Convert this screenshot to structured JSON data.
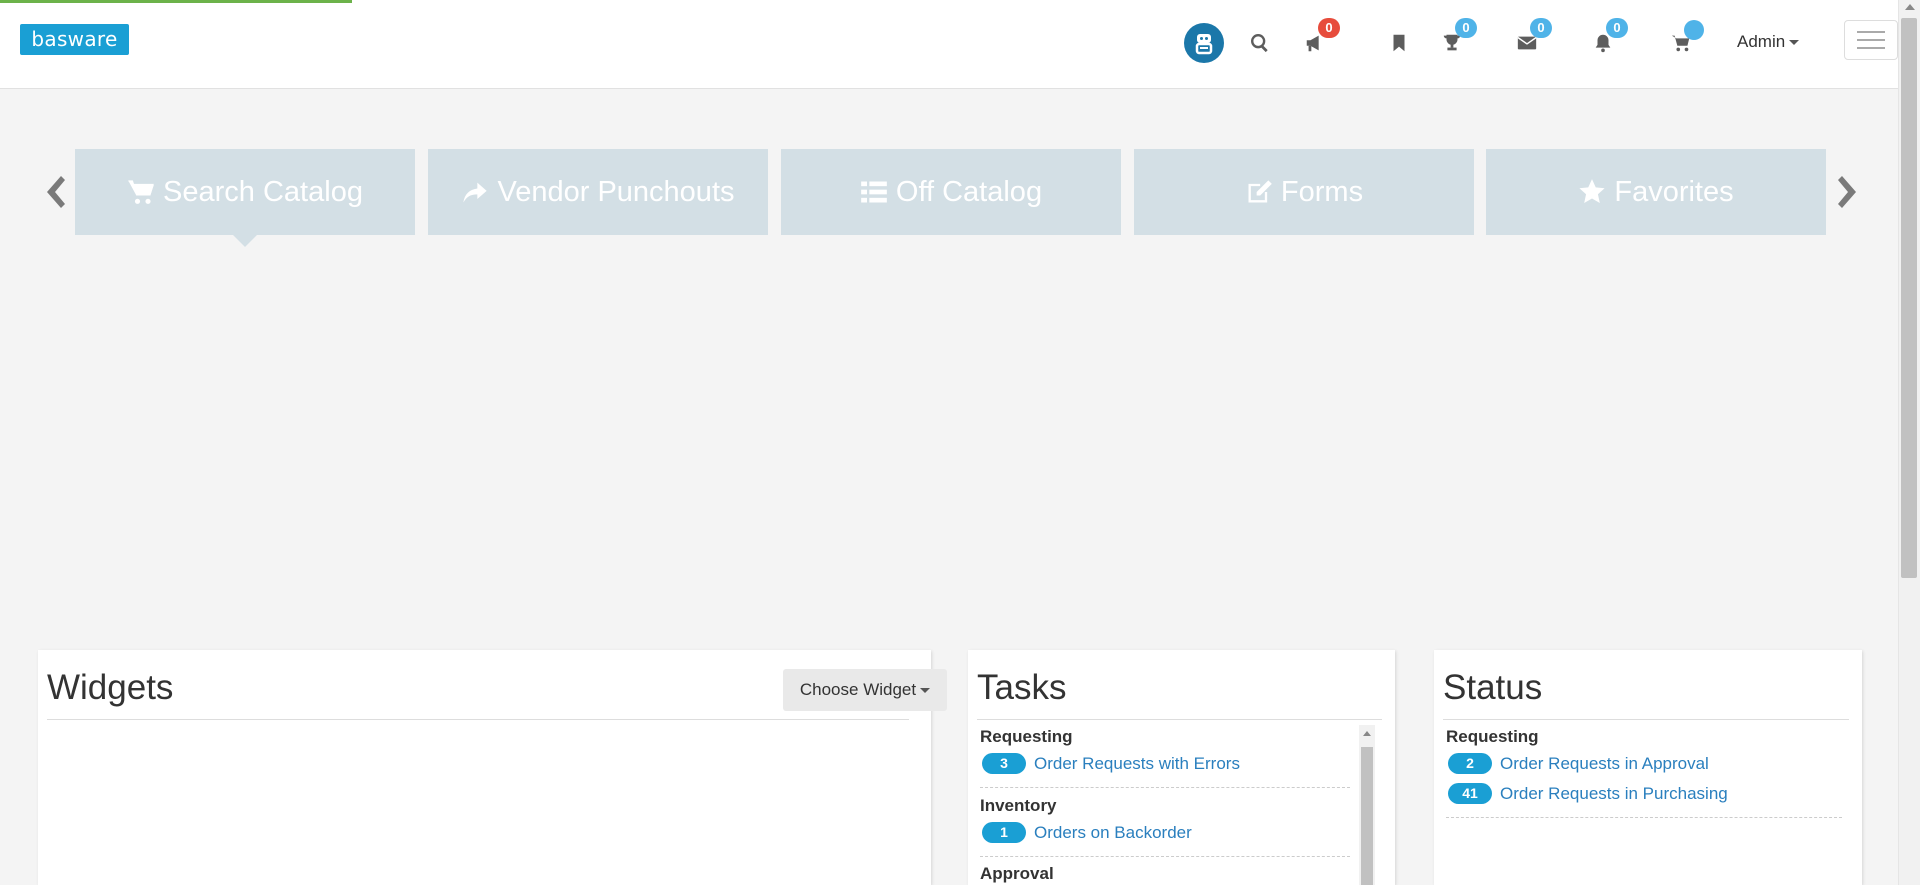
{
  "header": {
    "logo_text": "basware",
    "icons": [
      {
        "name": "search-icon"
      },
      {
        "name": "megaphone-icon",
        "badge": "0",
        "badge_color": "#e74c3c"
      },
      {
        "name": "bookmark-icon"
      },
      {
        "name": "trophy-icon",
        "badge": "0",
        "badge_color": "#4fb3e8"
      },
      {
        "name": "envelope-icon",
        "badge": "0",
        "badge_color": "#4fb3e8"
      },
      {
        "name": "bell-icon",
        "badge": "0",
        "badge_color": "#4fb3e8"
      },
      {
        "name": "cart-icon"
      }
    ],
    "megaphone_badge": "0",
    "trophy_badge": "0",
    "mail_badge": "0",
    "bell_badge": "0",
    "user_menu_label": "Admin"
  },
  "carousel": {
    "tiles": [
      {
        "label": "Search Catalog",
        "icon": "cart-icon"
      },
      {
        "label": "Vendor Punchouts",
        "icon": "share-arrow-icon"
      },
      {
        "label": "Off Catalog",
        "icon": "list-icon"
      },
      {
        "label": "Forms",
        "icon": "edit-icon"
      },
      {
        "label": "Favorites",
        "icon": "star-icon"
      }
    ]
  },
  "widgets": {
    "title": "Widgets",
    "choose_label": "Choose Widget"
  },
  "tasks": {
    "title": "Tasks",
    "groups": [
      {
        "title": "Requesting",
        "items": [
          {
            "count": "3",
            "label": "Order Requests with Errors"
          }
        ]
      },
      {
        "title": "Inventory",
        "items": [
          {
            "count": "1",
            "label": "Orders on Backorder"
          }
        ]
      },
      {
        "title": "Approval",
        "items": []
      }
    ]
  },
  "status": {
    "title": "Status",
    "groups": [
      {
        "title": "Requesting",
        "items": [
          {
            "count": "2",
            "label": "Order Requests in Approval"
          },
          {
            "count": "41",
            "label": "Order Requests in Purchasing"
          }
        ]
      }
    ]
  },
  "colors": {
    "accent": "#1a9fd4",
    "tile_bg": "#d3dfe5",
    "link": "#2a7fbe",
    "badge_red": "#e74c3c",
    "badge_blue": "#4fb3e8",
    "progress": "#6cb24a"
  }
}
